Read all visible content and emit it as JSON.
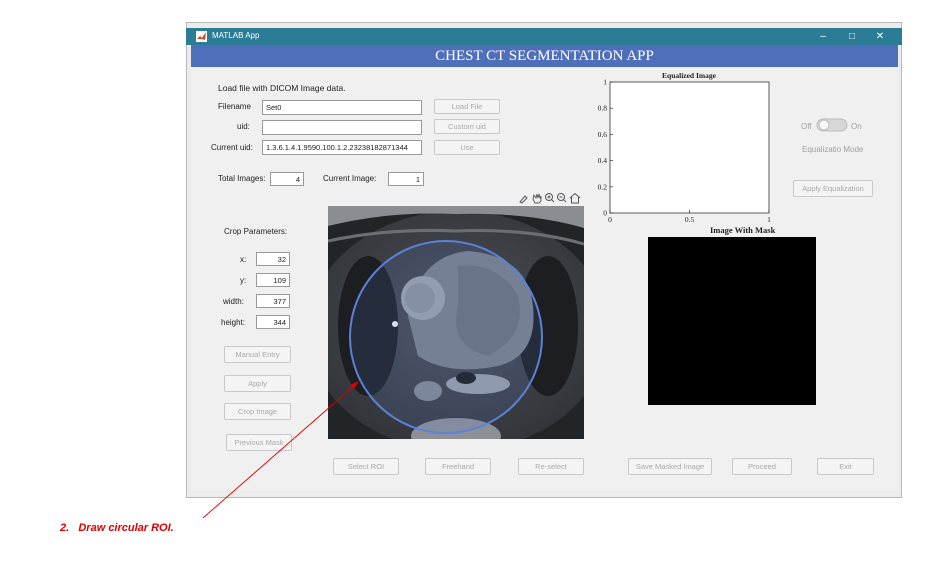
{
  "window": {
    "title": "MATLAB App",
    "controls": {
      "minimize": "–",
      "maximize": "□",
      "close": "✕"
    }
  },
  "header": {
    "title": "CHEST CT SEGMENTATION APP"
  },
  "load": {
    "heading": "Load file with DICOM Image data.",
    "filename_label": "Filename",
    "filename_value": "Set0",
    "uid_label": "uid:",
    "uid_value": "",
    "current_uid_label": "Current uid:",
    "current_uid_value": "1.3.6.1.4.1.9590.100.1.2.23238182871344",
    "load_file_btn": "Load File",
    "custom_uid_btn": "Custom uid",
    "use_btn": "Use"
  },
  "counts": {
    "total_label": "Total Images:",
    "total_value": "4",
    "current_label": "Current Image:",
    "current_value": "1"
  },
  "crop": {
    "heading": "Crop Parameters:",
    "x_label": "x:",
    "x_value": "32",
    "y_label": "y:",
    "y_value": "109",
    "width_label": "width:",
    "width_value": "377",
    "height_label": "height:",
    "height_value": "344",
    "manual_btn": "Manual Entry",
    "apply_btn": "Apply",
    "crop_btn": "Crop Image",
    "prev_mask_btn": "Previous Mask"
  },
  "roi_buttons": {
    "select": "Select ROI",
    "freehand": "Freehand",
    "reselect": "Re-select"
  },
  "right_buttons": {
    "save": "Save Masked Image",
    "proceed": "Proceed",
    "exit": "Exit"
  },
  "equalization": {
    "toggle_off": "Off",
    "toggle_on": "On",
    "toggle_state": "off",
    "mode_label": "Equalizatio Mode",
    "apply_btn": "Apply Equalization"
  },
  "chart_data": [
    {
      "type": "image",
      "title": "Equalized Image",
      "x_ticks": [
        "0",
        "0.5",
        "1"
      ],
      "y_ticks": [
        "0",
        "0.2",
        "0.4",
        "0.6",
        "0.8",
        "1"
      ],
      "xlim": [
        0,
        1
      ],
      "ylim": [
        0,
        1
      ]
    },
    {
      "type": "image",
      "title": "Image With Mask"
    }
  ],
  "colors": {
    "titlebar": "#2b7d95",
    "header": "#4f6fbb",
    "roi": "#5b82d6",
    "annotation": "#e00000"
  },
  "annotation": {
    "number": "2.",
    "text": "Draw circular ROI."
  }
}
